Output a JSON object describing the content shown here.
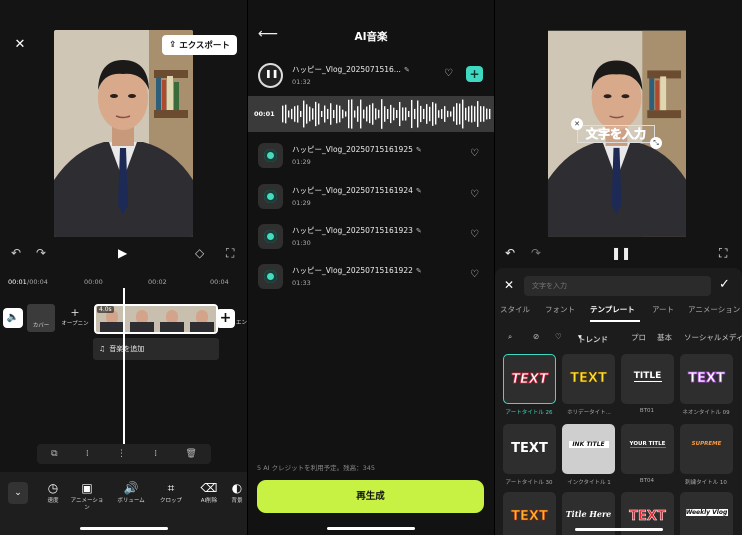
{
  "editor": {
    "export_label": "エクスポート",
    "time_current": "00:01",
    "time_total": "/00:04",
    "ticks": [
      "00:00",
      "00:02",
      "00:04"
    ],
    "cover_label": "カバー",
    "opening_label": "オープニン",
    "ending_label": "エンディン",
    "clip_duration": "4.0s",
    "add_music_label": "音楽を追加",
    "tools": [
      {
        "icon": "speed-icon",
        "label": "速度"
      },
      {
        "icon": "animation-icon",
        "label": "アニメーション"
      },
      {
        "icon": "volume-icon",
        "label": "ボリューム"
      },
      {
        "icon": "crop-icon",
        "label": "クロップ"
      },
      {
        "icon": "ai-erase-icon",
        "label": "AI削除"
      },
      {
        "icon": "background-icon",
        "label": "背景"
      }
    ]
  },
  "ai_music": {
    "title": "AI音楽",
    "playing_time": "00:01",
    "songs": [
      {
        "name": "ハッピー_Vlog_2025071516...",
        "duration": "01:32"
      },
      {
        "name": "ハッピー_Vlog_20250715161925",
        "duration": "01:29"
      },
      {
        "name": "ハッピー_Vlog_20250715161924",
        "duration": "01:29"
      },
      {
        "name": "ハッピー_Vlog_20250715161923",
        "duration": "01:30"
      },
      {
        "name": "ハッピー_Vlog_20250715161922",
        "duration": "01:33"
      }
    ],
    "credit_text": "5 AI クレジットを利用予定。残高：345",
    "regenerate_label": "再生成",
    "accent_color": "#c8f243"
  },
  "text_editor": {
    "overlay_text": "文字を入力",
    "input_placeholder": "文字を入力",
    "tabs": [
      "スタイル",
      "フォント",
      "テンプレート",
      "アート",
      "アニメーション"
    ],
    "active_tab": "テンプレート",
    "filters": [
      "トレンド",
      "プロ",
      "基本",
      "ソーシャルメディア"
    ],
    "templates": [
      {
        "label": "アートタイトル 26",
        "text": "TEXT",
        "selected": true
      },
      {
        "label": "ホリデータイト...",
        "text": "TEXT"
      },
      {
        "label": "BT01",
        "text": "TITLE"
      },
      {
        "label": "ネオンタイトル 09",
        "text": "TEXT"
      },
      {
        "label": "アートタイトル 30",
        "text": "TEXT"
      },
      {
        "label": "インクタイトル 1",
        "text": "INK TITLE"
      },
      {
        "label": "BT04",
        "text": "YOUR TITLE"
      },
      {
        "label": "刺繍タイトル 10",
        "text": "SUPREME"
      },
      {
        "label": "",
        "text": "TEXT"
      },
      {
        "label": "",
        "text": "Title Here"
      },
      {
        "label": "",
        "text": "TEXT"
      },
      {
        "label": "",
        "text": "Weekly Vlog"
      }
    ],
    "accent_color": "#3fd8c0"
  }
}
